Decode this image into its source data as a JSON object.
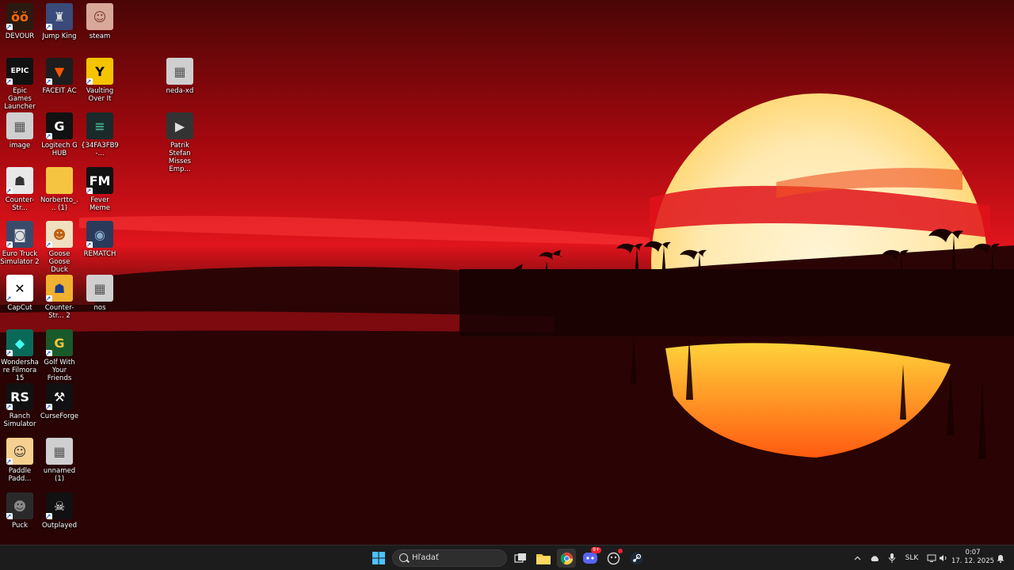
{
  "desktop": {
    "icons": [
      {
        "label": "DEVOUR",
        "icon": "devour-icon",
        "shortcut": true
      },
      {
        "label": "Jump King",
        "icon": "jump-king-icon",
        "shortcut": true
      },
      {
        "label": "steam",
        "icon": "steam-photo-icon",
        "shortcut": false
      },
      {
        "label": "Epic Games Launcher",
        "icon": "epic-games-icon",
        "shortcut": true
      },
      {
        "label": "FACEIT AC",
        "icon": "faceit-icon",
        "shortcut": true
      },
      {
        "label": "Vaulting Over It",
        "icon": "vaulting-over-it-icon",
        "shortcut": true
      },
      {
        "label": "neda-xd",
        "icon": "image-file-icon",
        "shortcut": false
      },
      {
        "label": "image",
        "icon": "image-file-icon",
        "shortcut": false
      },
      {
        "label": "Logitech G HUB",
        "icon": "logitech-icon",
        "shortcut": true
      },
      {
        "label": "{34FA3FB9-...",
        "icon": "screenshot-file-icon",
        "shortcut": false
      },
      {
        "label": "Patrik Stefan Misses Emp...",
        "icon": "video-file-icon",
        "shortcut": false
      },
      {
        "label": "Counter-Str...",
        "icon": "counter-strike-icon",
        "shortcut": true
      },
      {
        "label": "Norbertto_... (1)",
        "icon": "folder-icon",
        "shortcut": false
      },
      {
        "label": "Fever Meme",
        "icon": "fever-meme-icon",
        "shortcut": true
      },
      {
        "label": "Euro Truck Simulator 2",
        "icon": "euro-truck-icon",
        "shortcut": true
      },
      {
        "label": "Goose Goose Duck",
        "icon": "goose-icon",
        "shortcut": true
      },
      {
        "label": "REMATCH",
        "icon": "rematch-icon",
        "shortcut": true
      },
      {
        "label": "CapCut",
        "icon": "capcut-icon",
        "shortcut": true
      },
      {
        "label": "Counter-Str... 2",
        "icon": "cs2-icon",
        "shortcut": true
      },
      {
        "label": "nos",
        "icon": "image-file-icon",
        "shortcut": false
      },
      {
        "label": "Wondershare Filmora 15",
        "icon": "filmora-icon",
        "shortcut": true
      },
      {
        "label": "Golf With Your Friends",
        "icon": "golf-icon",
        "shortcut": true
      },
      {
        "label": "Ranch Simulator",
        "icon": "ranch-icon",
        "shortcut": true
      },
      {
        "label": "CurseForge",
        "icon": "curseforge-icon",
        "shortcut": true
      },
      {
        "label": "Paddle Padd...",
        "icon": "paddle-icon",
        "shortcut": true
      },
      {
        "label": "unnamed (1)",
        "icon": "image-file-icon",
        "shortcut": false
      },
      {
        "label": "Puck",
        "icon": "puck-icon",
        "shortcut": true
      },
      {
        "label": "Outplayed",
        "icon": "outplayed-icon",
        "shortcut": true
      }
    ]
  },
  "taskbar": {
    "search_placeholder": "Hľadať",
    "apps": [
      "start-icon",
      "task-view-icon",
      "file-explorer-icon",
      "chrome-icon",
      "discord-icon",
      "app-icon",
      "steam-icon"
    ],
    "discord_badge": "9+",
    "tray": {
      "language": "SLK",
      "time": "0:07",
      "date": "17. 12. 2025"
    }
  },
  "colors": {
    "sky_top": "#7a0d0d",
    "sky_mid": "#e0121a",
    "sun": "#fff3d0",
    "taskbar": "#1c1c1c"
  }
}
